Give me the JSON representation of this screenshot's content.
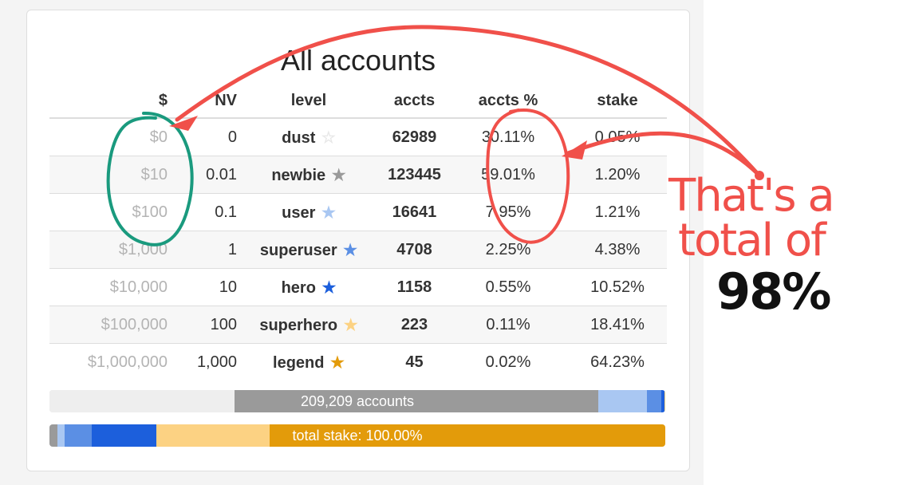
{
  "card": {
    "title": "All accounts"
  },
  "table": {
    "headers": [
      "$",
      "NV",
      "level",
      "accts",
      "accts %",
      "stake"
    ],
    "rows": [
      {
        "usd": "$0",
        "nv": "0",
        "level": "dust",
        "accts": "62989",
        "pct": "30.11%",
        "stake": "0.05%",
        "star": "☆",
        "star_color": "#e8e8e8"
      },
      {
        "usd": "$10",
        "nv": "0.01",
        "level": "newbie",
        "accts": "123445",
        "pct": "59.01%",
        "stake": "1.20%",
        "star": "★",
        "star_color": "#9a9a9a"
      },
      {
        "usd": "$100",
        "nv": "0.1",
        "level": "user",
        "accts": "16641",
        "pct": "7.95%",
        "stake": "1.21%",
        "star": "★",
        "star_color": "#a9c7f2"
      },
      {
        "usd": "$1,000",
        "nv": "1",
        "level": "superuser",
        "accts": "4708",
        "pct": "2.25%",
        "stake": "4.38%",
        "star": "★",
        "star_color": "#5b8fe4"
      },
      {
        "usd": "$10,000",
        "nv": "10",
        "level": "hero",
        "accts": "1158",
        "pct": "0.55%",
        "stake": "10.52%",
        "star": "★",
        "star_color": "#1c5fdc"
      },
      {
        "usd": "$100,000",
        "nv": "100",
        "level": "superhero",
        "accts": "223",
        "pct": "0.11%",
        "stake": "18.41%",
        "star": "★",
        "star_color": "#fcd283"
      },
      {
        "usd": "$1,000,000",
        "nv": "1,000",
        "level": "legend",
        "accts": "45",
        "pct": "0.02%",
        "stake": "64.23%",
        "star": "★",
        "star_color": "#e39b0a"
      }
    ]
  },
  "bars": {
    "accounts_label": "209,209 accounts",
    "stake_label": "total stake: 100.00%",
    "accounts_fractions": [
      0.3011,
      0.5901,
      0.0795,
      0.0225,
      0.0055,
      0.0011,
      0.0002
    ],
    "stake_fractions": [
      0.0005,
      0.012,
      0.0121,
      0.0438,
      0.1052,
      0.1841,
      0.6423
    ],
    "segment_colors": [
      "#eeeeee",
      "#9a9a9a",
      "#a9c7f2",
      "#5b8fe4",
      "#1c5fdc",
      "#fcd283",
      "#e39b0a"
    ]
  },
  "annotation": {
    "line1": "That's a",
    "line2": "total of",
    "emphasis": "98%",
    "color": "#f0504a",
    "usd_circle_color": "#1a9a7e"
  }
}
